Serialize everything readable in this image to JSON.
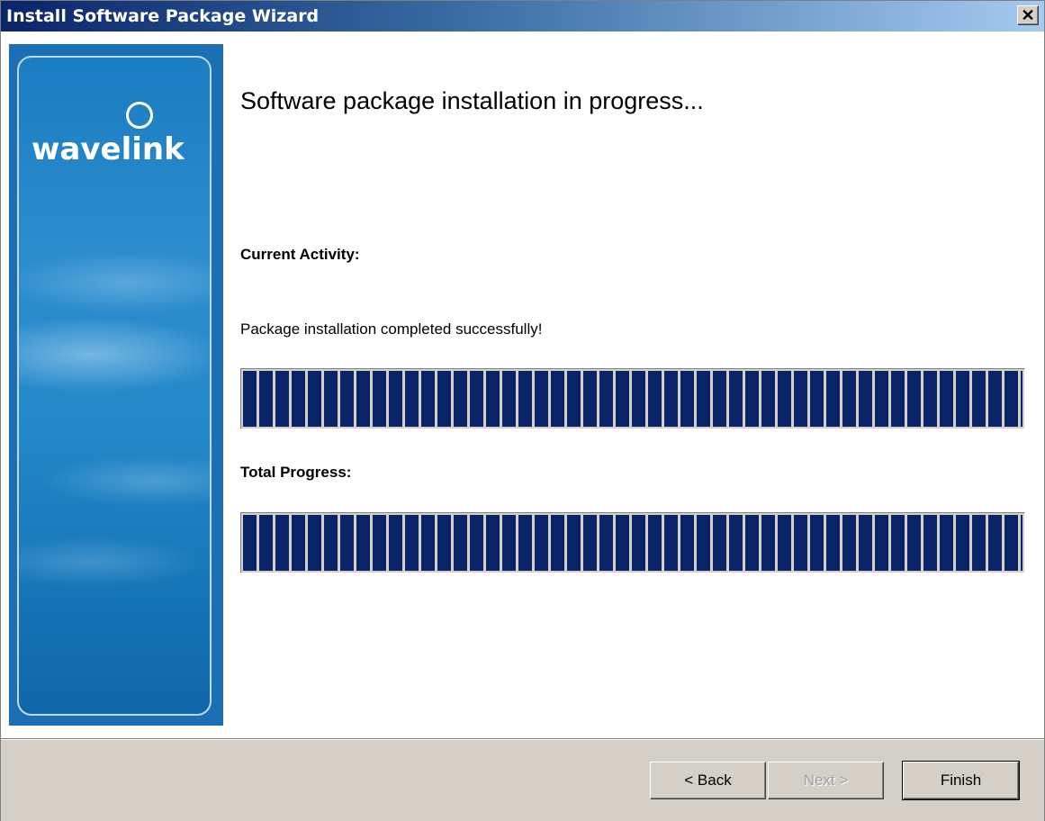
{
  "window": {
    "title": "Install Software Package Wizard",
    "close_symbol": "✕"
  },
  "sidebar": {
    "logo_text": "wavelink"
  },
  "content": {
    "heading": "Software package installation in progress...",
    "current_activity_label": "Current Activity:",
    "current_activity_text": "Package installation completed successfully!",
    "current_activity_progress": 1.0,
    "total_progress_label": "Total Progress:",
    "total_progress": 1.0
  },
  "buttons": {
    "back_label": "< Back",
    "next_label": "Next >",
    "finish_label": "Finish"
  },
  "colors": {
    "titlebar_start": "#0a246a",
    "titlebar_end": "#a6caf0",
    "progress_fill": "#0a246a",
    "sidebar_blue": "#1a6fb5"
  }
}
